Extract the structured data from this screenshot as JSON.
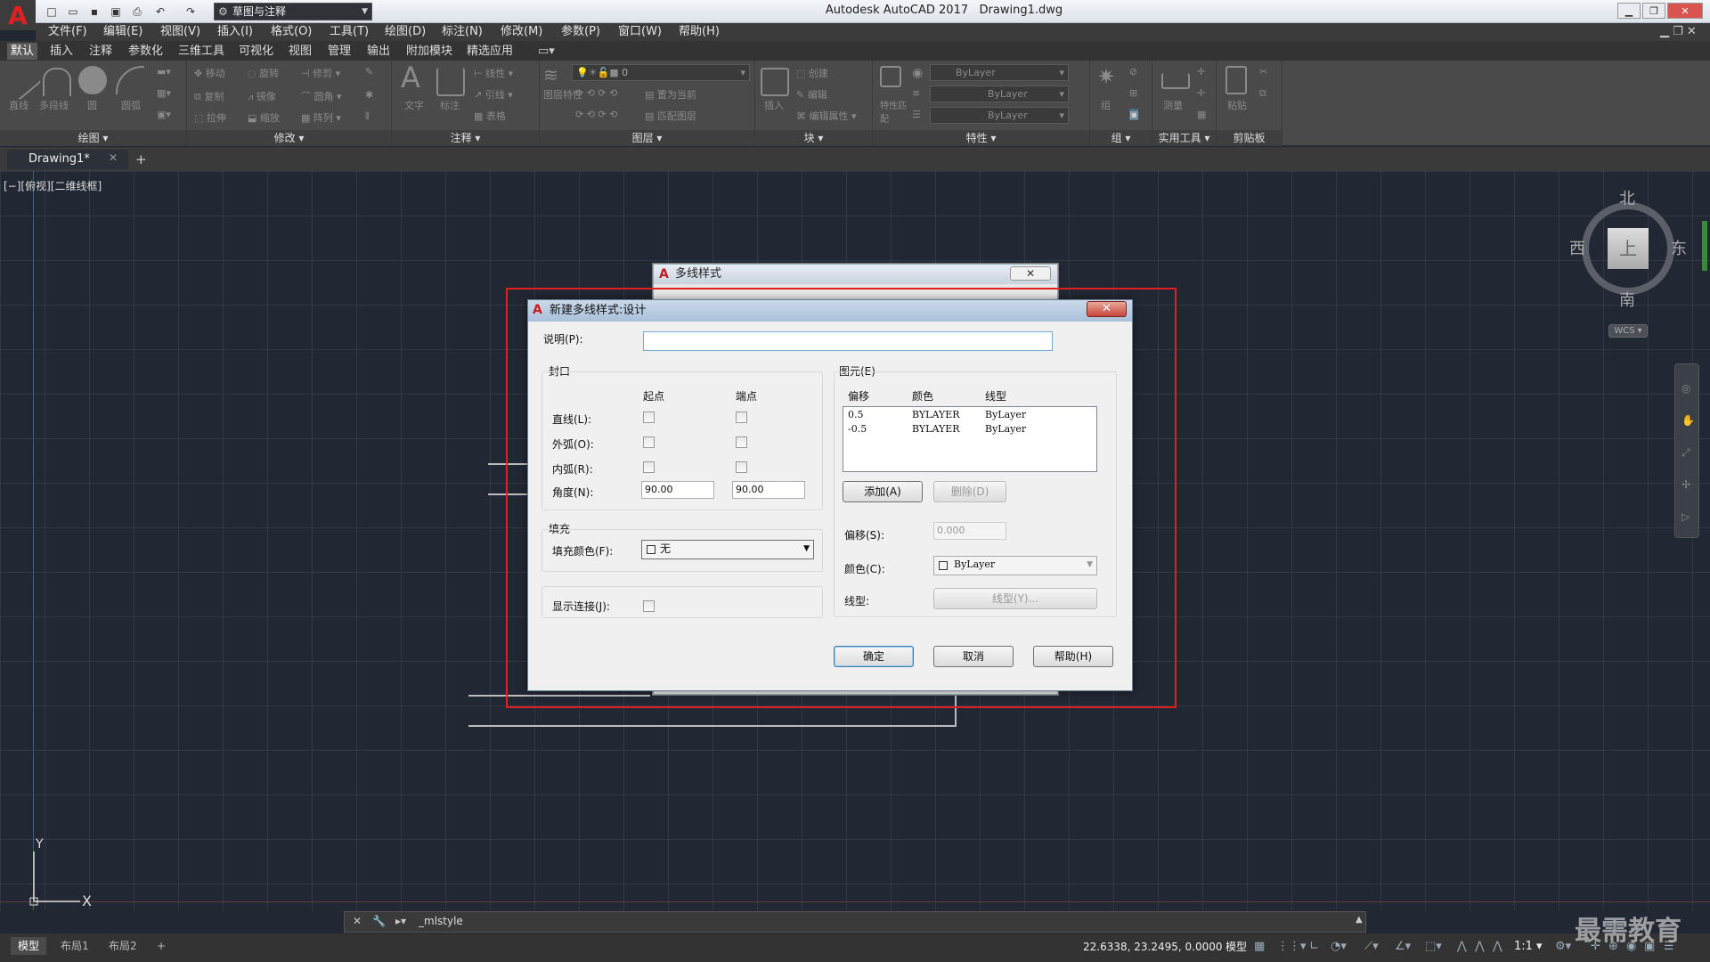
{
  "app": {
    "logo": "A",
    "title": "Autodesk AutoCAD 2017",
    "doc": "Drawing1.dwg",
    "workspace": "草图与注释"
  },
  "menu": [
    "文件(F)",
    "编辑(E)",
    "视图(V)",
    "插入(I)",
    "格式(O)",
    "工具(T)",
    "绘图(D)",
    "标注(N)",
    "修改(M)",
    "参数(P)",
    "窗口(W)",
    "帮助(H)"
  ],
  "ribbon_tabs": [
    "默认",
    "插入",
    "注释",
    "参数化",
    "三维工具",
    "可视化",
    "视图",
    "管理",
    "输出",
    "附加模块",
    "精选应用"
  ],
  "panels": [
    "绘图",
    "修改",
    "注释",
    "图层",
    "块",
    "特性",
    "组",
    "实用工具",
    "剪贴板"
  ],
  "draw_tools": [
    "直线",
    "多段线",
    "圆",
    "圆弧"
  ],
  "modify_tools": [
    "移动",
    "旋转",
    "修剪",
    "复制",
    "镜像",
    "圆角",
    "拉伸",
    "缩放",
    "阵列"
  ],
  "annot_tools": [
    "文字",
    "标注",
    "线性",
    "引线",
    "表格"
  ],
  "layer_tools": [
    "图层特性",
    "置为当前",
    "匹配图层"
  ],
  "layer_value": "0",
  "block_tools": [
    "插入",
    "创建",
    "编辑",
    "编辑属性"
  ],
  "props": {
    "label": "特性匹配",
    "color": "ByLayer",
    "linetype": "ByLayer",
    "lineweight": "ByLayer"
  },
  "util_tools": [
    "组",
    "测量",
    "粘贴"
  ],
  "doc_tab": "Drawing1*",
  "viewport_label": "[−][俯视][二维线框]",
  "viewcube": {
    "n": "北",
    "s": "南",
    "e": "东",
    "w": "西",
    "face": "上",
    "wcs": "WCS"
  },
  "ucs": {
    "x": "X",
    "y": "Y"
  },
  "dialog_bg": {
    "title": "多线样式"
  },
  "dialog": {
    "title": "新建多线样式:设计",
    "desc_label": "说明(P):",
    "desc_value": "",
    "caps": {
      "title": "封口",
      "start": "起点",
      "end": "端点",
      "line": "直线(L):",
      "outer": "外弧(O):",
      "inner": "内弧(R):",
      "angle": "角度(N):",
      "angle_start": "90.00",
      "angle_end": "90.00"
    },
    "fill": {
      "title": "填充",
      "color_label": "填充颜色(F):",
      "color_value": "无"
    },
    "joints_label": "显示连接(J):",
    "elements": {
      "title": "图元(E)",
      "cols": [
        "偏移",
        "颜色",
        "线型"
      ],
      "rows": [
        {
          "offset": "0.5",
          "color": "BYLAYER",
          "ltype": "ByLayer"
        },
        {
          "offset": "-0.5",
          "color": "BYLAYER",
          "ltype": "ByLayer"
        }
      ],
      "add": "添加(A)",
      "delete": "删除(D)",
      "offset_label": "偏移(S):",
      "offset_value": "0.000",
      "color_label": "颜色(C):",
      "color_value": "ByLayer",
      "ltype_label": "线型:",
      "ltype_btn": "线型(Y)..."
    },
    "ok": "确定",
    "cancel": "取消",
    "help": "帮助(H)"
  },
  "command": "_mlstyle",
  "layout_tabs": [
    "模型",
    "布局1",
    "布局2"
  ],
  "status": {
    "coords": "22.6338, 23.2495, 0.0000",
    "model": "模型",
    "scale": "1:1"
  },
  "watermark": "最需教育",
  "colors": {
    "accent": "#e02020",
    "bg": "#212733"
  }
}
